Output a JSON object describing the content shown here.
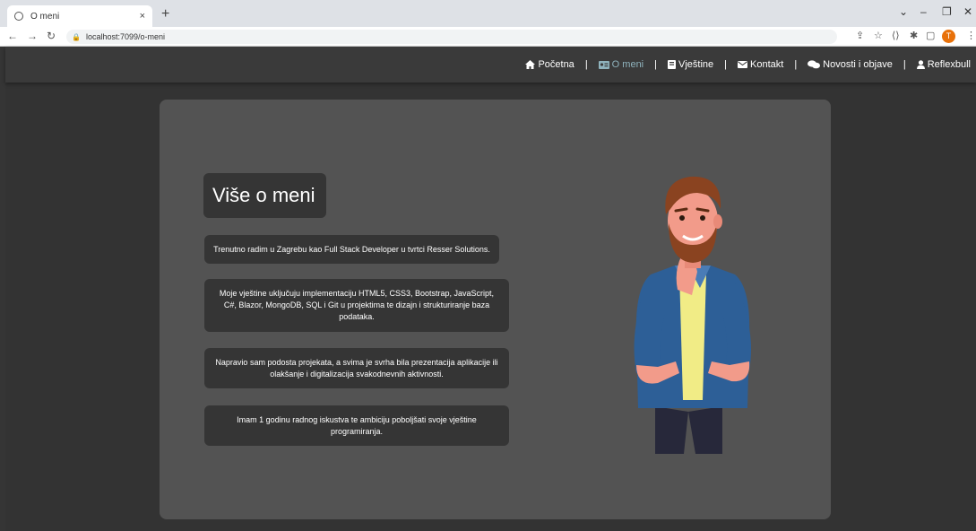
{
  "browser": {
    "tab_title": "O meni",
    "tab_close": "×",
    "new_tab": "+",
    "url": "localhost:7099/o-meni",
    "profile_initial": "T"
  },
  "nav": {
    "items": [
      {
        "label": "Početna",
        "icon": "home-icon"
      },
      {
        "label": "O meni",
        "icon": "id-card-icon",
        "active": true
      },
      {
        "label": "Vještine",
        "icon": "book-icon"
      },
      {
        "label": "Kontakt",
        "icon": "envelope-icon"
      },
      {
        "label": "Novosti i objave",
        "icon": "chat-bubbles-icon"
      },
      {
        "label": "Reflexbull",
        "icon": "user-icon"
      }
    ],
    "separator": "|"
  },
  "about": {
    "title": "Više o meni",
    "paragraphs": [
      "Trenutno radim u Zagrebu kao Full Stack Developer u tvrtci Resser Solutions.",
      "Moje vještine uključuju implementaciju HTML5, CSS3, Bootstrap, JavaScript, C#, Blazor, MongoDB, SQL i Git u projektima te dizajn i strukturiranje baza podataka.",
      "Napravio sam podosta projekata, a svima je svrha bila prezentacija aplikacije ili olakšanje i digitalizacija svakodnevnih aktivnosti.",
      "Imam 1 godinu radnog iskustva te ambiciju poboljšati svoje vještine programiranja."
    ]
  },
  "colors": {
    "page_bg": "#333333",
    "panel_bg": "#535353",
    "box_bg": "#353535",
    "active_nav": "#8fb3bd"
  }
}
